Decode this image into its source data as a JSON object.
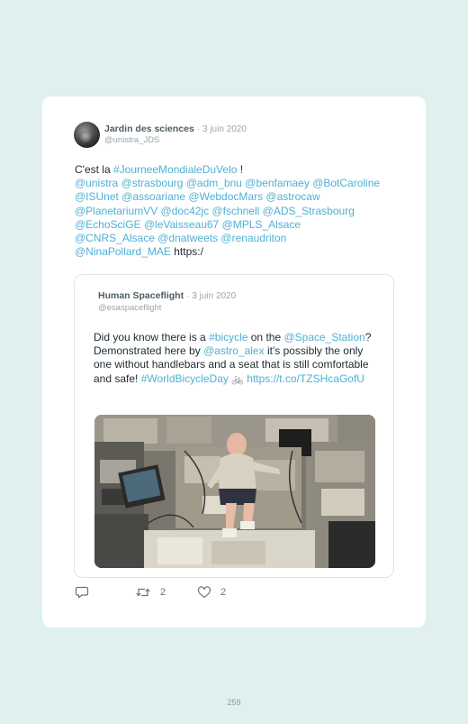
{
  "tweet": {
    "author": {
      "name": "Jardin des sciences",
      "separator": "·",
      "date": "3 juin 2020",
      "handle": "@unistra_JDS"
    },
    "text_segments": [
      {
        "text": "C'est la ",
        "link": false
      },
      {
        "text": "#JourneeMondialeDuVelo",
        "link": true
      },
      {
        "text": " !",
        "link": false
      },
      {
        "text": "\n",
        "link": false
      },
      {
        "text": "@unistra @strasbourg @adm_bnu @benfamaey @BotCaroline @ISUnet @assoariane @WebdocMars @astrocaw @PlanetariumVV @doc42jc @fschnell @ADS_Strasbourg @EchoSciGE @leVaisseau67 @MPLS_Alsace @CNRS_Alsace @dnatweets @renaudriton @NinaPollard_MAE",
        "link": true
      },
      {
        "text": " https:/",
        "link": false
      }
    ],
    "quoted": {
      "author": {
        "name": "Human Spaceflight",
        "separator": "·",
        "date": "3 juin 2020",
        "handle": "@esaspaceflight"
      },
      "text_segments": [
        {
          "text": "Did you know there is a ",
          "link": false
        },
        {
          "text": "#bicycle",
          "link": true
        },
        {
          "text": " on the ",
          "link": false
        },
        {
          "text": "@Space_Station",
          "link": true
        },
        {
          "text": "? Demonstrated here by ",
          "link": false
        },
        {
          "text": "@astro_alex",
          "link": true
        },
        {
          "text": " it's possibly the only one without handlebars and a seat that is still comfortable and safe! ",
          "link": false
        },
        {
          "text": "#WorldBicycleDay",
          "link": true
        },
        {
          "text": " ",
          "link": false
        },
        {
          "text": "🚲",
          "link": false,
          "emoji": true
        },
        {
          "text": " ",
          "link": false
        },
        {
          "text": "https://t.co/TZSHcaGofU",
          "link": true
        }
      ],
      "media": {
        "icon": "iss-interior-photo"
      }
    },
    "actions": {
      "reply": {
        "icon": "reply-icon"
      },
      "retweet": {
        "icon": "retweet-icon",
        "count": "2"
      },
      "like": {
        "icon": "heart-icon",
        "count": "2"
      }
    }
  },
  "page_number": "259",
  "colors": {
    "background": "#dff0ef",
    "card": "#ffffff",
    "link": "#4fb0d6",
    "text": "#1f2a30",
    "muted": "#9aa6ab"
  }
}
